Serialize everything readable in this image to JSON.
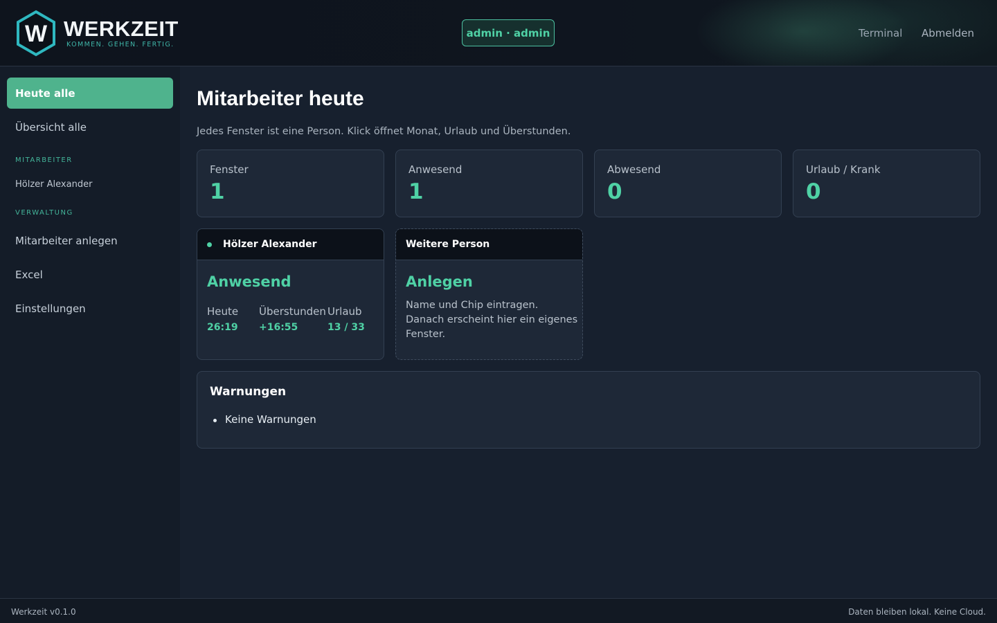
{
  "colors": {
    "accent": "#4fd1a5",
    "active_nav": "#4fb38d",
    "background": "#17202e",
    "card": "#1e2837",
    "header": "#0e141d"
  },
  "header": {
    "logo_letter": "W",
    "app_name": "WERKZEIT",
    "tagline": "KOMMEN. GEHEN. FERTIG.",
    "user_badge": "admin · admin",
    "links": {
      "terminal": "Terminal",
      "logout": "Abmelden"
    }
  },
  "sidebar": {
    "items": [
      {
        "label": "Heute alle",
        "active": true
      },
      {
        "label": "Übersicht alle",
        "active": false
      }
    ],
    "section_employees": "MITARBEITER",
    "employees": [
      "Hölzer Alexander"
    ],
    "section_admin": "VERWALTUNG",
    "admin_items": [
      "Mitarbeiter anlegen",
      "Excel",
      "Einstellungen"
    ]
  },
  "main": {
    "title": "Mitarbeiter heute",
    "subtitle": "Jedes Fenster ist eine Person. Klick öffnet Monat, Urlaub und Überstunden.",
    "stats": [
      {
        "label": "Fenster",
        "value": "1"
      },
      {
        "label": "Anwesend",
        "value": "1"
      },
      {
        "label": "Abwesend",
        "value": "0"
      },
      {
        "label": "Urlaub / Krank",
        "value": "0"
      }
    ],
    "person_card": {
      "name": "Hölzer Alexander",
      "status": "Anwesend",
      "metrics": [
        {
          "label": "Heute",
          "value": "26:19"
        },
        {
          "label": "Überstunden",
          "value": "+16:55"
        },
        {
          "label": "Urlaub",
          "value": "13 / 33"
        }
      ]
    },
    "add_card": {
      "title": "Weitere Person",
      "action": "Anlegen",
      "description": "Name und Chip eintragen. Danach erscheint hier ein eigenes Fenster."
    },
    "warnings": {
      "title": "Warnungen",
      "items": [
        "Keine Warnungen"
      ]
    }
  },
  "footer": {
    "version": "Werkzeit v0.1.0",
    "note": "Daten bleiben lokal. Keine Cloud."
  }
}
